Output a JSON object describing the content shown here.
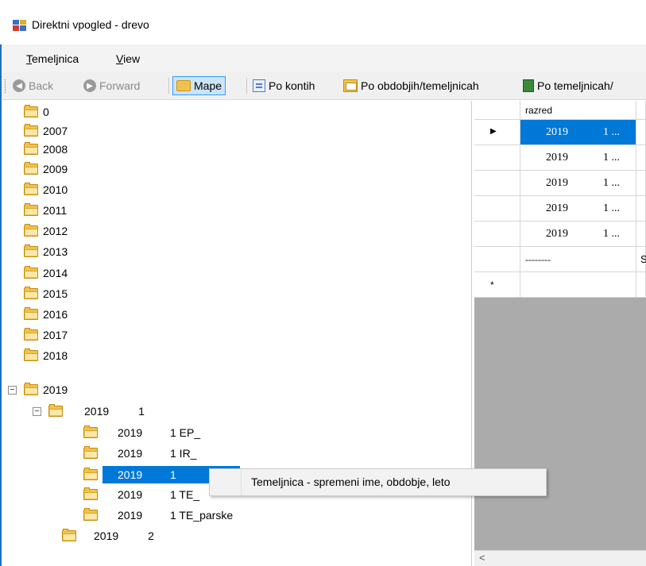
{
  "window": {
    "title": "Direktni vpogled - drevo",
    "icon": "app-window-icon"
  },
  "menu": {
    "items": [
      {
        "label": "Temeljnica",
        "accel": "T",
        "rest": "emeljnica"
      },
      {
        "label": "View",
        "accel": "V",
        "rest": "iew"
      }
    ]
  },
  "toolbar": {
    "back": "Back",
    "forward": "Forward",
    "mape": "Mape",
    "po_kontih": "Po kontih",
    "po_obdobjih": "Po obdobjih/temeljnicah",
    "po_temeljnicah": "Po temeljnicah/"
  },
  "tree": {
    "top_folders": [
      "0",
      "2007",
      "2008",
      "2009",
      "2010",
      "2011",
      "2012",
      "2013",
      "2014",
      "2015",
      "2016",
      "2017",
      "2018",
      "2019"
    ],
    "sub_2019_1": {
      "year": "2019",
      "num": "1"
    },
    "leaves": [
      {
        "year": "2019",
        "label": "1 EP_"
      },
      {
        "year": "2019",
        "label": "1 IR_"
      },
      {
        "year": "2019",
        "label": "1"
      },
      {
        "year": "2019",
        "label": "1 TE_"
      },
      {
        "year": "2019",
        "label": "1 TE_parske"
      }
    ],
    "sub_2019_2": {
      "year": "2019",
      "num": "2"
    }
  },
  "grid": {
    "column_header": "razred",
    "rows": [
      {
        "year": "2019",
        "num": "1 ..."
      },
      {
        "year": "2019",
        "num": "1 ..."
      },
      {
        "year": "2019",
        "num": "1 ..."
      },
      {
        "year": "2019",
        "num": "1 ..."
      },
      {
        "year": "2019",
        "num": "1 ..."
      }
    ],
    "separator_row": "--------",
    "separator_tail": "S",
    "new_row_marker": "*",
    "current_row_marker": "▶",
    "scroll_left": "<"
  },
  "context_menu": {
    "item": "Temeljnica - spremeni ime, obdobje, leto"
  }
}
